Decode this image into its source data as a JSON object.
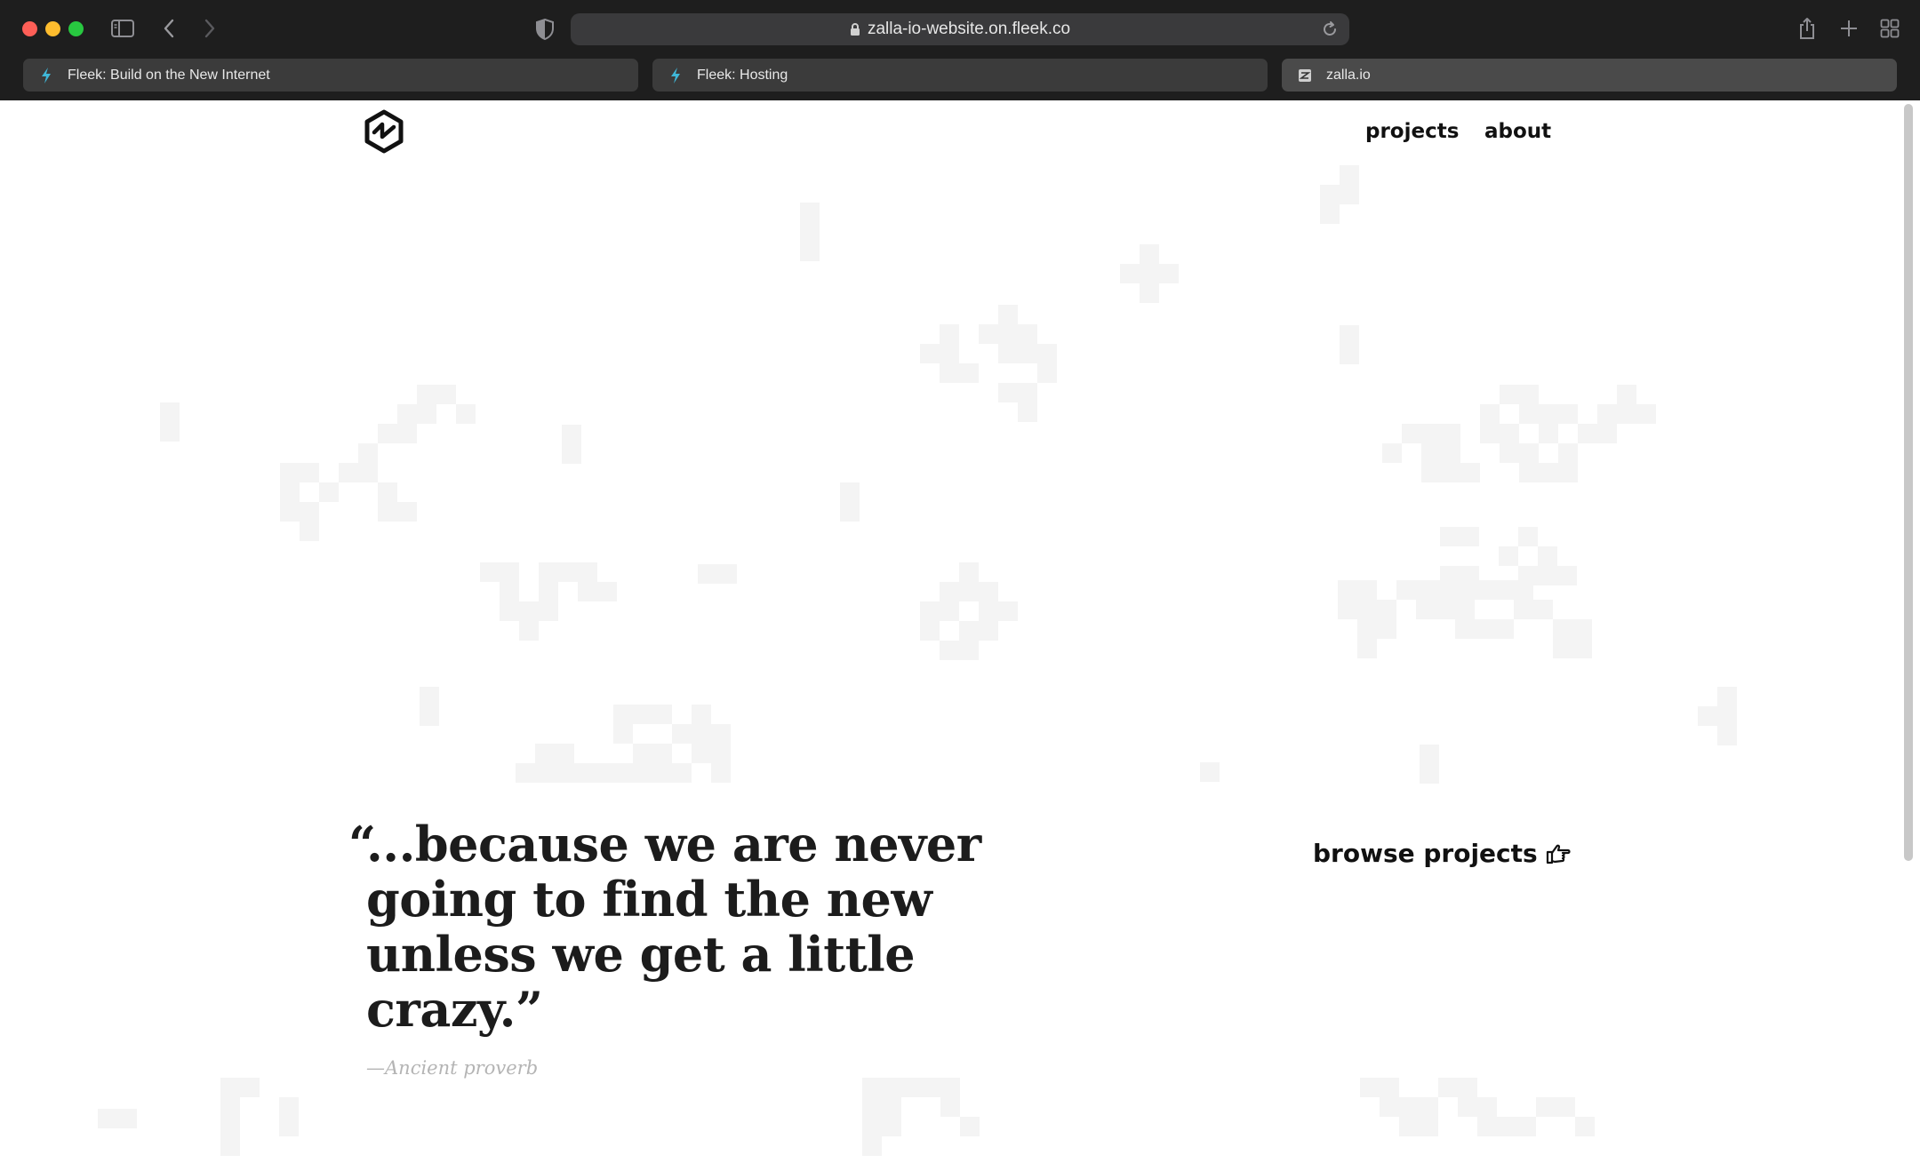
{
  "browser": {
    "url": "zalla-io-website.on.fleek.co",
    "tabs": [
      {
        "title": "Fleek: Build on the New Internet",
        "favicon": "fleek-bolt-icon"
      },
      {
        "title": "Fleek: Hosting",
        "favicon": "fleek-bolt-icon"
      },
      {
        "title": "zalla.io",
        "favicon": "zalla-favicon"
      }
    ],
    "active_tab": 2
  },
  "site": {
    "nav": {
      "projects": "projects",
      "about": "about"
    },
    "quote": {
      "open_mark": "“",
      "text": "...because we are never going to find the new unless we get a little crazy.”",
      "attribution": "—Ancient proverb"
    },
    "cta": {
      "label": "browse projects",
      "icon": "pointing-hand-icon"
    }
  },
  "colors": {
    "chrome_bg": "#1e1e1e",
    "page_bg": "#ffffff",
    "text": "#111111",
    "attribution": "#b4b4b4",
    "pixel_pattern": "#f4f4f4"
  }
}
